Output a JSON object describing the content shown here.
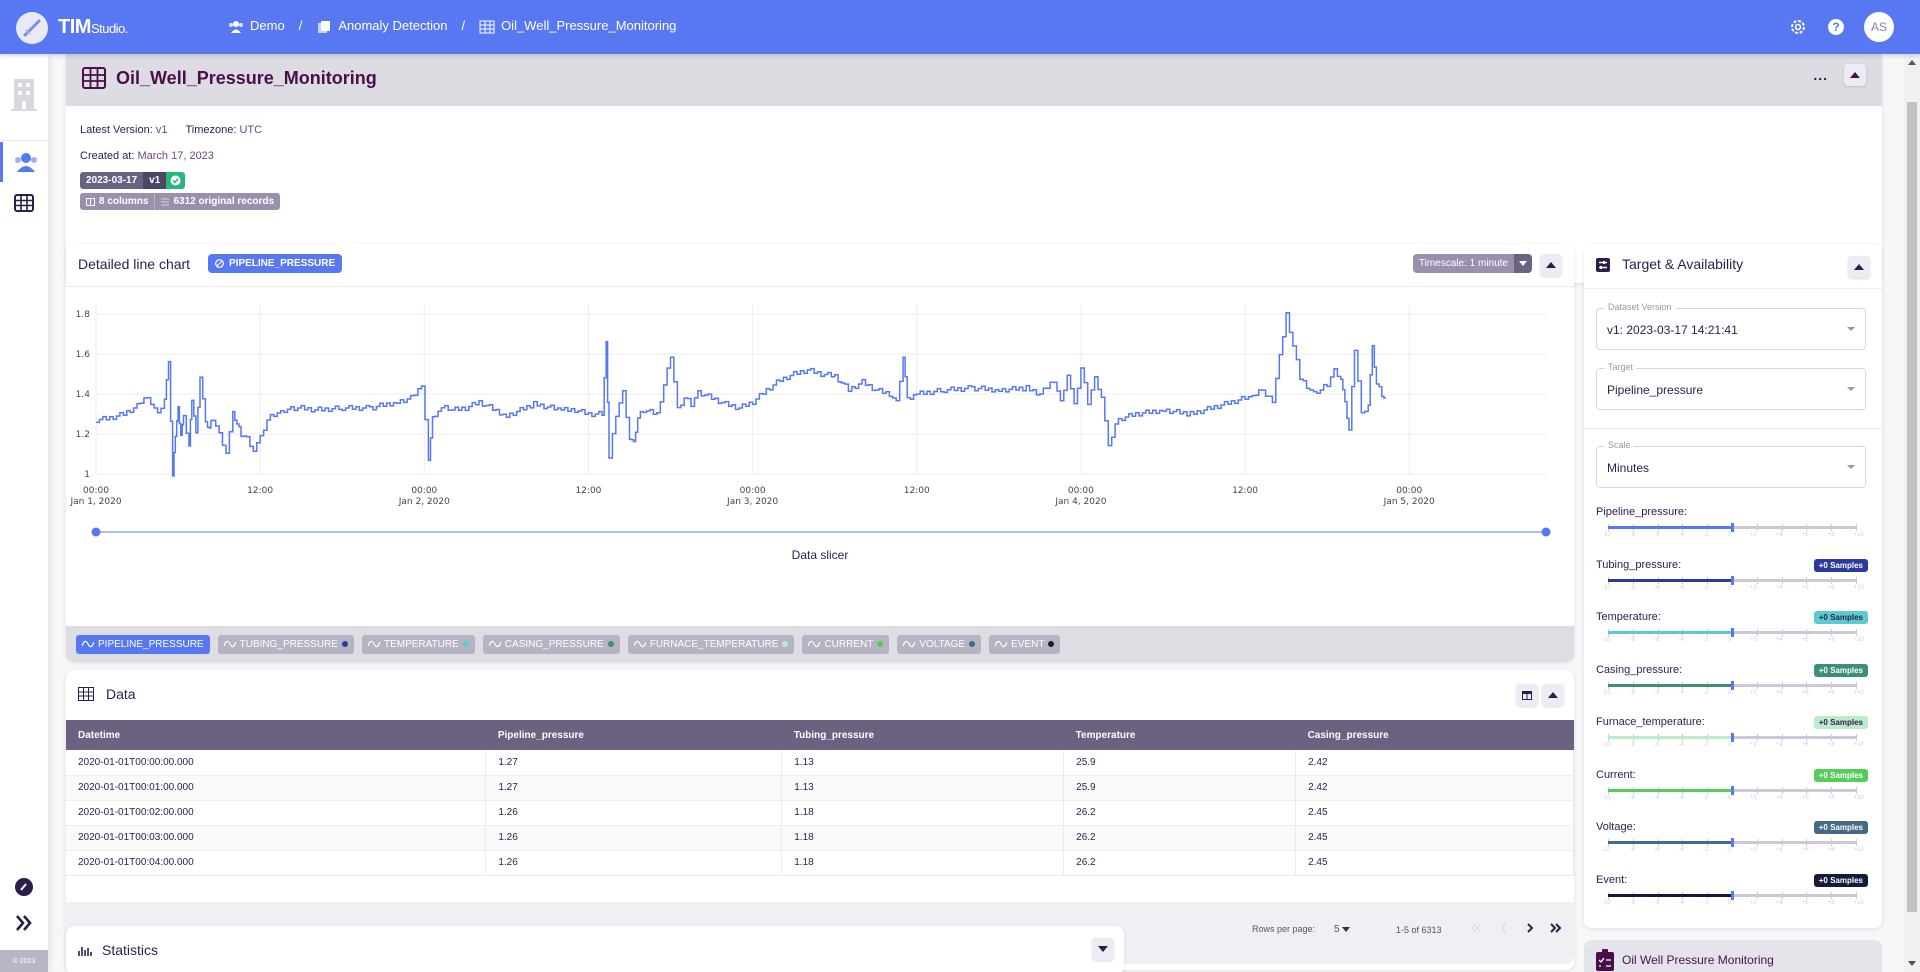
{
  "app": {
    "name": "TIM",
    "name_suffix": "Studio."
  },
  "breadcrumb": [
    {
      "label": "Demo",
      "icon": "users-icon"
    },
    {
      "label": "Anomaly Detection",
      "icon": "copy-icon"
    },
    {
      "label": "Oil_Well_Pressure_Monitoring",
      "icon": "table-icon"
    }
  ],
  "breadcrumb_separator": "/",
  "user": {
    "initials": "AS"
  },
  "sidebar": {
    "copyright": "© 2023"
  },
  "dataset": {
    "title": "Oil_Well_Pressure_Monitoring",
    "latest_version_label": "Latest Version:",
    "latest_version": "v1",
    "timezone_label": "Timezone:",
    "timezone": "UTC",
    "created_label": "Created at:",
    "created": "March 17, 2023",
    "tag_date": "2023-03-17",
    "tag_version": "v1",
    "columns": "8 columns",
    "records": "6312 original records",
    "more": "..."
  },
  "chart_card": {
    "title": "Detailed line chart",
    "badge": "PIPELINE_PRESSURE",
    "timescale": "Timescale: 1 minute",
    "slicer_label": "Data slicer",
    "legend": [
      {
        "label": "PIPELINE_PRESSURE",
        "color": "#5778f0",
        "active": true
      },
      {
        "label": "TUBING_PRESSURE",
        "color": "#2b3a9e",
        "active": false
      },
      {
        "label": "TEMPERATURE",
        "color": "#5ccbd0",
        "active": false
      },
      {
        "label": "CASING_PRESSURE",
        "color": "#3e8f7a",
        "active": false
      },
      {
        "label": "FURNACE_TEMPERATURE",
        "color": "#bdeccb",
        "active": false
      },
      {
        "label": "CURRENT",
        "color": "#55cc5c",
        "active": false
      },
      {
        "label": "VOLTAGE",
        "color": "#456a84",
        "active": false
      },
      {
        "label": "EVENT",
        "color": "#141a3a",
        "active": false
      }
    ]
  },
  "chart_data": {
    "type": "line",
    "title": "Detailed line chart",
    "series": [
      {
        "name": "PIPELINE_PRESSURE",
        "color": "#5778f0",
        "x_hours": [
          0,
          1,
          2,
          3,
          3.5,
          4,
          4.5,
          5,
          5.3,
          5.6,
          5.8,
          6,
          6.2,
          6.4,
          6.8,
          7,
          7.3,
          7.6,
          8,
          8.3,
          8.5,
          9,
          9.5,
          10,
          10.3,
          10.6,
          11,
          11.5,
          12,
          12.5,
          13,
          13.5,
          14,
          15,
          16,
          18,
          20,
          22,
          23,
          23.8,
          24.3,
          24.6,
          25,
          25.5,
          26,
          27,
          28,
          30,
          32,
          34,
          35,
          36,
          37,
          37.3,
          37.5,
          38,
          38.5,
          39,
          39.3,
          39.6,
          40,
          41,
          42,
          42.5,
          43,
          43.5,
          44,
          45,
          46,
          47,
          48,
          49,
          50,
          51,
          52,
          53,
          54,
          55,
          56,
          57,
          58,
          58.5,
          59,
          59.3,
          60,
          62,
          64,
          66,
          68,
          69,
          70,
          70.5,
          71,
          71.5,
          72,
          72.5,
          73,
          73.5,
          74,
          74.5,
          75,
          76,
          78,
          80,
          81,
          82,
          83,
          84,
          84.5,
          85,
          86,
          87,
          88,
          89,
          89.5,
          90,
          90.5,
          91,
          91.3,
          91.6,
          92,
          92.5,
          93,
          93.3,
          93.6,
          94,
          94.3,
          94.6,
          95,
          95.5,
          96
        ],
        "y": [
          1.27,
          1.28,
          1.3,
          1.34,
          1.38,
          1.36,
          1.3,
          1.38,
          1.55,
          0.99,
          1.2,
          1.33,
          1.2,
          1.28,
          1.14,
          1.38,
          1.2,
          1.49,
          1.25,
          1.23,
          1.28,
          1.2,
          1.11,
          1.3,
          1.25,
          1.2,
          1.18,
          1.12,
          1.18,
          1.27,
          1.3,
          1.31,
          1.33,
          1.33,
          1.32,
          1.33,
          1.33,
          1.36,
          1.38,
          1.44,
          1.08,
          1.28,
          1.32,
          1.33,
          1.32,
          1.33,
          1.36,
          1.29,
          1.35,
          1.32,
          1.32,
          1.3,
          1.3,
          1.65,
          1.08,
          1.3,
          1.41,
          1.18,
          1.15,
          1.28,
          1.32,
          1.3,
          1.59,
          1.32,
          1.38,
          1.35,
          1.41,
          1.38,
          1.35,
          1.33,
          1.36,
          1.42,
          1.47,
          1.5,
          1.52,
          1.5,
          1.49,
          1.42,
          1.46,
          1.42,
          1.4,
          1.36,
          1.59,
          1.37,
          1.4,
          1.42,
          1.43,
          1.42,
          1.43,
          1.4,
          1.47,
          1.36,
          1.5,
          1.34,
          1.53,
          1.36,
          1.48,
          1.39,
          1.13,
          1.25,
          1.28,
          1.3,
          1.32,
          1.3,
          1.32,
          1.34,
          1.36,
          1.38,
          1.38,
          1.42,
          1.37,
          1.8,
          1.48,
          1.4,
          1.42,
          1.45,
          1.52,
          1.48,
          1.35,
          1.22,
          1.63,
          1.3,
          1.35,
          1.63,
          1.45,
          1.4,
          1.36
        ]
      }
    ],
    "x_ticks": [
      {
        "time": "00:00",
        "date": "Jan 1, 2020"
      },
      {
        "time": "12:00",
        "date": ""
      },
      {
        "time": "00:00",
        "date": "Jan 2, 2020"
      },
      {
        "time": "12:00",
        "date": ""
      },
      {
        "time": "00:00",
        "date": "Jan 3, 2020"
      },
      {
        "time": "12:00",
        "date": ""
      },
      {
        "time": "00:00",
        "date": "Jan 4, 2020"
      },
      {
        "time": "12:00",
        "date": ""
      },
      {
        "time": "00:00",
        "date": "Jan 5, 2020"
      }
    ],
    "x_range_hours": [
      0,
      106
    ],
    "y_ticks": [
      "1",
      "1.2",
      "1.4",
      "1.6",
      "1.8"
    ],
    "ylim": [
      1,
      1.8
    ],
    "grid": true
  },
  "data_table": {
    "title": "Data",
    "columns": [
      "Datetime",
      "Pipeline_pressure",
      "Tubing_pressure",
      "Temperature",
      "Casing_pressure"
    ],
    "rows": [
      [
        "2020-01-01T00:00:00.000",
        "1.27",
        "1.13",
        "25.9",
        "2.42"
      ],
      [
        "2020-01-01T00:01:00.000",
        "1.27",
        "1.13",
        "25.9",
        "2.42"
      ],
      [
        "2020-01-01T00:02:00.000",
        "1.26",
        "1.18",
        "26.2",
        "2.45"
      ],
      [
        "2020-01-01T00:03:00.000",
        "1.26",
        "1.18",
        "26.2",
        "2.45"
      ],
      [
        "2020-01-01T00:04:00.000",
        "1.26",
        "1.18",
        "26.2",
        "2.45"
      ]
    ],
    "rows_per_page_label": "Rows per page:",
    "rows_per_page": "5",
    "range": "1-5 of 6313"
  },
  "statistics": {
    "title": "Statistics"
  },
  "target_panel": {
    "title": "Target & Availability",
    "dataset_version_label": "Dataset Version",
    "dataset_version": "v1: 2023-03-17 14:21:41",
    "target_label": "Target",
    "target": "Pipeline_pressure",
    "scale_label": "Scale",
    "scale": "Minutes",
    "tick_labels": [
      "-10",
      "-8",
      "-6",
      "-4",
      "-2",
      "0",
      "+2",
      "+4",
      "+6",
      "+8",
      "+10"
    ],
    "availability": [
      {
        "label": "Pipeline_pressure:",
        "color": "#5778f0",
        "badge": "",
        "value": 0
      },
      {
        "label": "Tubing_pressure:",
        "color": "#2b3a9e",
        "badge": "+0 Samples",
        "value": 0
      },
      {
        "label": "Temperature:",
        "color": "#5ccbd0",
        "badge": "+0 Samples",
        "value": 0
      },
      {
        "label": "Casing_pressure:",
        "color": "#3e8f7a",
        "badge": "+0 Samples",
        "value": 0
      },
      {
        "label": "Furnace_temperature:",
        "color": "#bdeccb",
        "badge": "+0 Samples",
        "value": 0
      },
      {
        "label": "Current:",
        "color": "#55cc5c",
        "badge": "+0 Samples",
        "value": 0
      },
      {
        "label": "Voltage:",
        "color": "#456a84",
        "badge": "+0 Samples",
        "value": 0
      },
      {
        "label": "Event:",
        "color": "#141a3a",
        "badge": "+0 Samples",
        "value": 0
      }
    ]
  },
  "bottom_tab": {
    "label": "Oil Well Pressure Monitoring"
  }
}
